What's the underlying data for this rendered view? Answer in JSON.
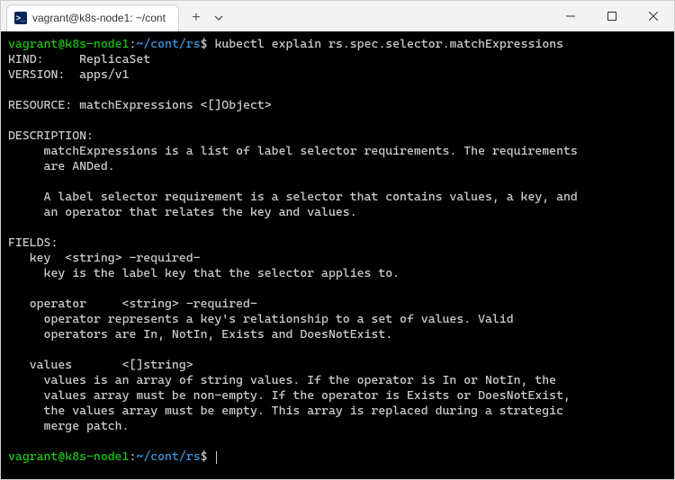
{
  "titlebar": {
    "tab": {
      "icon_label": ">_",
      "title": "vagrant@k8s-node1: ~/cont"
    },
    "new_tab_glyph": "+"
  },
  "prompt1": {
    "user": "vagrant@k8s-node1",
    "sep": ":",
    "path": "~/cont/rs",
    "dollar": "$",
    "command": "kubectl explain rs.spec.selector.matchExpressions"
  },
  "output": {
    "kind_label": "KIND:     ",
    "kind_value": "ReplicaSet",
    "version_label": "VERSION:  ",
    "version_value": "apps/v1",
    "resource_line": "RESOURCE: matchExpressions <[]Object>",
    "description_header": "DESCRIPTION:",
    "description_body1": "     matchExpressions is a list of label selector requirements. The requirements",
    "description_body2": "     are ANDed.",
    "description_body3": "     A label selector requirement is a selector that contains values, a key, and",
    "description_body4": "     an operator that relates the key and values.",
    "fields_header": "FIELDS:",
    "key_line": "   key  <string> -required-",
    "key_desc": "     key is the label key that the selector applies to.",
    "operator_line": "   operator     <string> -required-",
    "operator_desc1": "     operator represents a key's relationship to a set of values. Valid",
    "operator_desc2": "     operators are In, NotIn, Exists and DoesNotExist.",
    "values_line": "   values       <[]string>",
    "values_desc1": "     values is an array of string values. If the operator is In or NotIn, the",
    "values_desc2": "     values array must be non-empty. If the operator is Exists or DoesNotExist,",
    "values_desc3": "     the values array must be empty. This array is replaced during a strategic",
    "values_desc4": "     merge patch."
  },
  "prompt2": {
    "user": "vagrant@k8s-node1",
    "sep": ":",
    "path": "~/cont/rs",
    "dollar": "$"
  }
}
